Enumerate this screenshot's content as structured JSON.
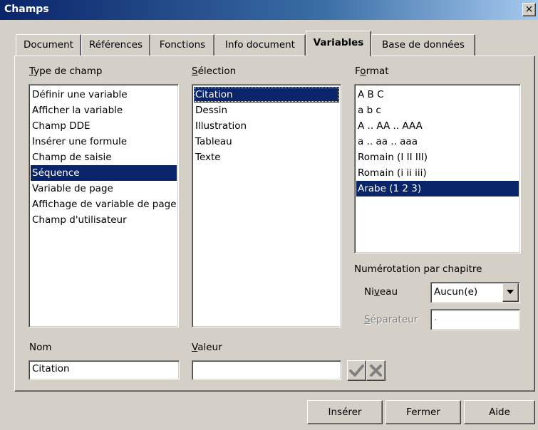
{
  "window": {
    "title": "Champs",
    "close_glyph": "×"
  },
  "tabs": [
    {
      "label": "Document"
    },
    {
      "label": "Références"
    },
    {
      "label": "Fonctions"
    },
    {
      "label": "Info document"
    },
    {
      "label": "Variables",
      "active": true
    },
    {
      "label": "Base de données"
    }
  ],
  "type_de_champ": {
    "label_first": "T",
    "label_rest": "ype de champ",
    "items": [
      "Définir une variable",
      "Afficher la variable",
      "Champ DDE",
      "Insérer une formule",
      "Champ de saisie",
      "Séquence",
      "Variable de page",
      "Affichage de variable de page",
      "Champ d'utilisateur"
    ],
    "selected": "Séquence"
  },
  "selection": {
    "label_first": "S",
    "label_rest": "élection",
    "items": [
      "Citation",
      "Dessin",
      "Illustration",
      "Tableau",
      "Texte"
    ],
    "selected": "Citation"
  },
  "format": {
    "label_pre": "F",
    "label_u": "o",
    "label_rest": "rmat",
    "items": [
      "A B C",
      "a b c",
      "A .. AA .. AAA",
      "a .. aa .. aaa",
      "Romain (I II III)",
      "Romain (i ii iii)",
      "Arabe (1 2 3)"
    ],
    "selected": "Arabe (1 2 3)"
  },
  "chapter_numbering": {
    "title": "Numérotation par chapitre",
    "niveau_pre": "Ni",
    "niveau_u": "v",
    "niveau_rest": "eau",
    "niveau_value": "Aucun(e)",
    "separateur_first": "S",
    "separateur_rest": "éparateur",
    "separateur_value": "."
  },
  "nom": {
    "label": "Nom",
    "value": "Citation"
  },
  "valeur": {
    "label_first": "V",
    "label_rest": "aleur",
    "value": ""
  },
  "icons": {
    "apply": "checkmark-icon",
    "cancel": "x-icon"
  },
  "buttons": {
    "insert": "Insérer",
    "close": "Fermer",
    "help": "Aide"
  }
}
